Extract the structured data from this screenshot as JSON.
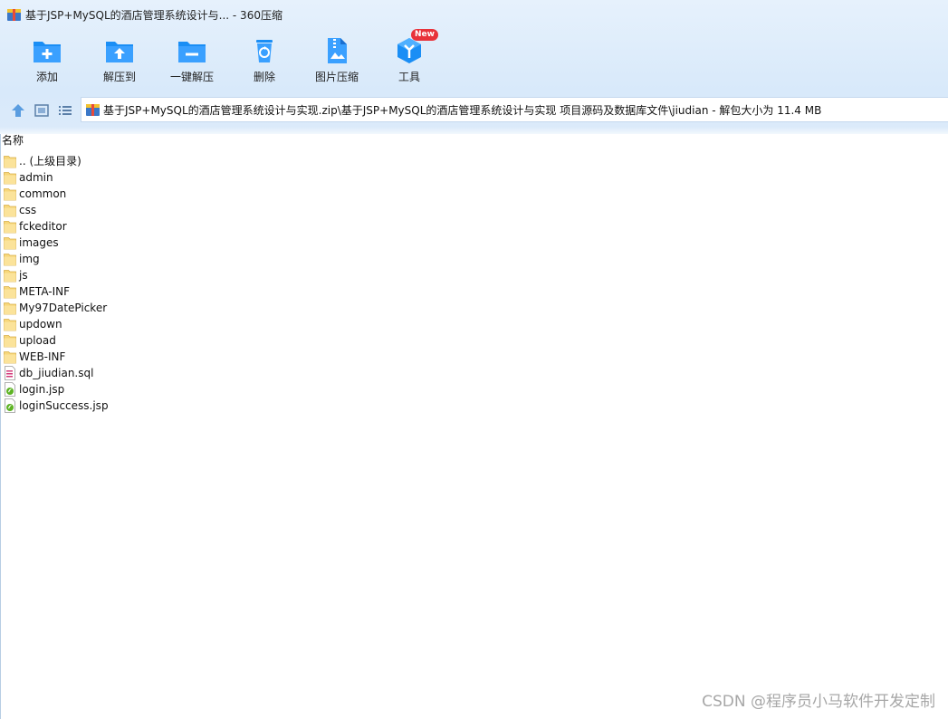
{
  "window": {
    "title": "基于JSP+MySQL的酒店管理系统设计与... - 360压缩"
  },
  "toolbar": {
    "add": "添加",
    "extract_to": "解压到",
    "one_click_extract": "一键解压",
    "delete": "删除",
    "image_compress": "图片压缩",
    "tools": "工具",
    "tools_badge": "New"
  },
  "address_bar": {
    "path": "基于JSP+MySQL的酒店管理系统设计与实现.zip\\基于JSP+MySQL的酒店管理系统设计与实现 项目源码及数据库文件\\jiudian - 解包大小为 11.4 MB"
  },
  "list": {
    "column_name": "名称",
    "items": [
      {
        "name": ".. (上级目录)",
        "type": "folder"
      },
      {
        "name": "admin",
        "type": "folder"
      },
      {
        "name": "common",
        "type": "folder"
      },
      {
        "name": "css",
        "type": "folder"
      },
      {
        "name": "fckeditor",
        "type": "folder"
      },
      {
        "name": "images",
        "type": "folder"
      },
      {
        "name": "img",
        "type": "folder"
      },
      {
        "name": "js",
        "type": "folder"
      },
      {
        "name": "META-INF",
        "type": "folder"
      },
      {
        "name": "My97DatePicker",
        "type": "folder"
      },
      {
        "name": "updown",
        "type": "folder"
      },
      {
        "name": "upload",
        "type": "folder"
      },
      {
        "name": "WEB-INF",
        "type": "folder"
      },
      {
        "name": "db_jiudian.sql",
        "type": "sql"
      },
      {
        "name": "login.jsp",
        "type": "jsp"
      },
      {
        "name": "loginSuccess.jsp",
        "type": "jsp"
      }
    ]
  },
  "watermark": "CSDN @程序员小马软件开发定制",
  "colors": {
    "accent_blue": "#1a8ef5",
    "folder_yellow": "#f7d77a",
    "badge_red": "#e8323a"
  }
}
